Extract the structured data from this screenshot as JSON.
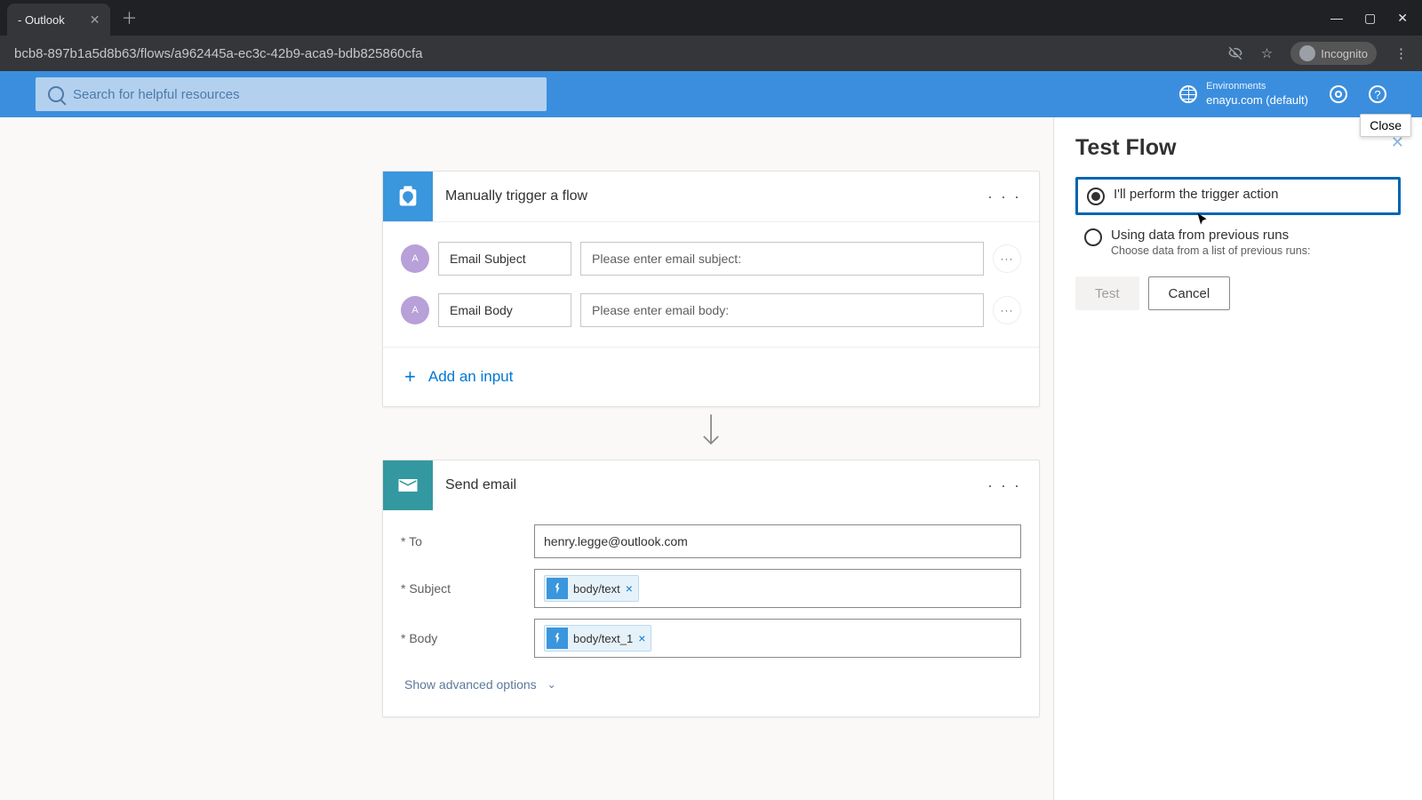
{
  "browser": {
    "tab_title": "- Outlook",
    "url": "bcb8-897b1a5d8b63/flows/a962445a-ec3c-42b9-aca9-bdb825860cfa",
    "incognito_label": "Incognito",
    "close_tooltip": "Close"
  },
  "header": {
    "search_placeholder": "Search for helpful resources",
    "env_label": "Environments",
    "env_value": "enayu.com (default)"
  },
  "trigger": {
    "title": "Manually trigger a flow",
    "inputs": [
      {
        "label": "Email Subject",
        "placeholder": "Please enter email subject:"
      },
      {
        "label": "Email Body",
        "placeholder": "Please enter email body:"
      }
    ],
    "add_input": "Add an input"
  },
  "email": {
    "title": "Send email",
    "to_label": "* To",
    "to_value": "henry.legge@outlook.com",
    "subject_label": "* Subject",
    "subject_token": "body/text",
    "body_label": "* Body",
    "body_token": "body/text_1",
    "show_advanced": "Show advanced options"
  },
  "panel": {
    "title": "Test Flow",
    "opt1": "I'll perform the trigger action",
    "opt2": "Using data from previous runs",
    "opt2_sub": "Choose data from a list of previous runs:",
    "test": "Test",
    "cancel": "Cancel"
  }
}
